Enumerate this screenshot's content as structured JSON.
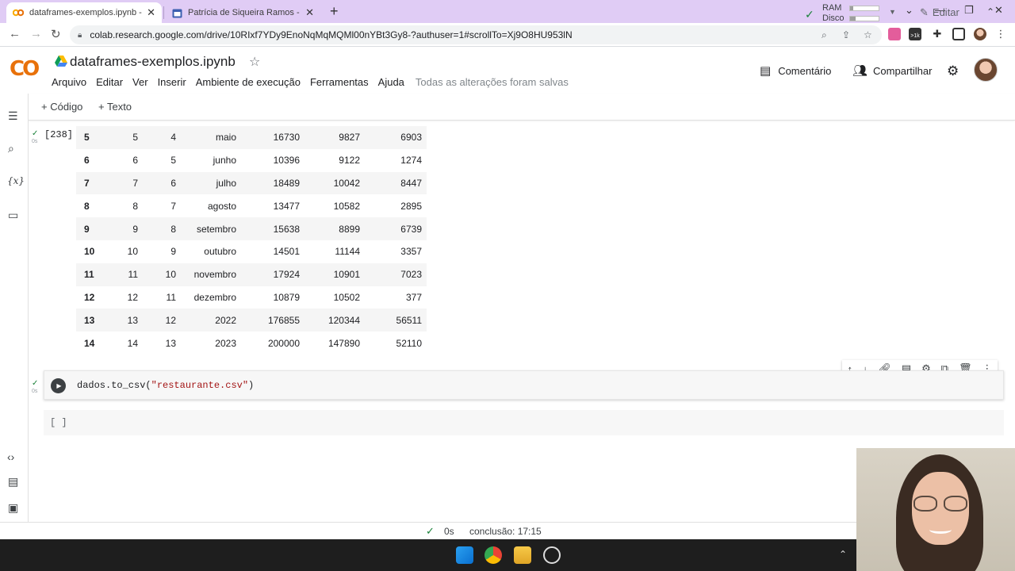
{
  "browser": {
    "tabs": [
      {
        "title": "dataframes-exemplos.ipynb - Co",
        "active": true
      },
      {
        "title": "Patrícia de Siqueira Ramos - proc",
        "active": false
      }
    ],
    "url": "colab.research.google.com/drive/10RIxf7YDy9EnoNqMqMQMl00nYBt3Gy8-?authuser=1#scrollTo=Xj9O8HU953lN",
    "ext_badge": ">1k"
  },
  "header": {
    "logo": "CO",
    "notebook_title": "dataframes-exemplos.ipynb",
    "menu": [
      "Arquivo",
      "Editar",
      "Ver",
      "Inserir",
      "Ambiente de execução",
      "Ferramentas",
      "Ajuda"
    ],
    "save_status": "Todas as alterações foram salvas",
    "comment_label": "Comentário",
    "share_label": "Compartilhar"
  },
  "cell_toolbar": {
    "add_code": "+ Código",
    "add_text": "+ Texto",
    "ram_label": "RAM",
    "disk_label": "Disco",
    "ram_level": 0.12,
    "disk_level": 0.2,
    "edit_label": "Editar"
  },
  "output_cell": {
    "exec_count": "[238]",
    "exec_time": "0s",
    "rows": [
      [
        "5",
        "5",
        "4",
        "maio",
        "16730",
        "9827",
        "6903"
      ],
      [
        "6",
        "6",
        "5",
        "junho",
        "10396",
        "9122",
        "1274"
      ],
      [
        "7",
        "7",
        "6",
        "julho",
        "18489",
        "10042",
        "8447"
      ],
      [
        "8",
        "8",
        "7",
        "agosto",
        "13477",
        "10582",
        "2895"
      ],
      [
        "9",
        "9",
        "8",
        "setembro",
        "15638",
        "8899",
        "6739"
      ],
      [
        "10",
        "10",
        "9",
        "outubro",
        "14501",
        "11144",
        "3357"
      ],
      [
        "11",
        "11",
        "10",
        "novembro",
        "17924",
        "10901",
        "7023"
      ],
      [
        "12",
        "12",
        "11",
        "dezembro",
        "10879",
        "10502",
        "377"
      ],
      [
        "13",
        "13",
        "12",
        "2022",
        "176855",
        "120344",
        "56511"
      ],
      [
        "14",
        "14",
        "13",
        "2023",
        "200000",
        "147890",
        "52110"
      ]
    ]
  },
  "code_cell": {
    "exec_time": "0s",
    "code_prefix": "dados.to_csv(",
    "code_string": "\"restaurante.csv\"",
    "code_suffix": ")"
  },
  "empty_cell": {
    "placeholder": "[ ]"
  },
  "status_bar": {
    "elapsed": "0s",
    "completion": "conclusão: 17:15"
  },
  "colors": {
    "tabstrip": "#e0ccf5",
    "logo_primary": "#f9ab00",
    "logo_secondary": "#e8710a",
    "success": "#188038"
  }
}
